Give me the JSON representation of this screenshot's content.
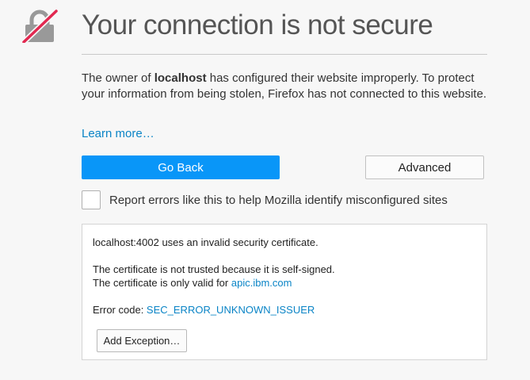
{
  "page": {
    "title": "Your connection is not secure",
    "description": {
      "before_host": "The owner of ",
      "host": "localhost",
      "after_host": " has configured their website improperly. To protect your information from being stolen, Firefox has not connected to this website."
    },
    "learn_more": "Learn more…",
    "go_back_label": "Go Back",
    "advanced_label": "Advanced",
    "report_checkbox_label": "Report errors like this to help Mozilla identify misconfigured sites",
    "report_checked": false
  },
  "details": {
    "summary": "localhost:4002 uses an invalid security certificate.",
    "reason_1": "The certificate is not trusted because it is self-signed.",
    "reason_2_prefix": "The certificate is only valid for ",
    "reason_2_domain": "apic.ibm.com",
    "error_code_prefix": "Error code: ",
    "error_code": "SEC_ERROR_UNKNOWN_ISSUER",
    "add_exception_label": "Add Exception…"
  },
  "icons": {
    "warning_icon": "lock-slashed-icon"
  },
  "colors": {
    "background": "#f7f7f7",
    "primary_button": "#0996f8",
    "link": "#0a84c6",
    "slash": "#e22850",
    "lock": "#999999"
  }
}
